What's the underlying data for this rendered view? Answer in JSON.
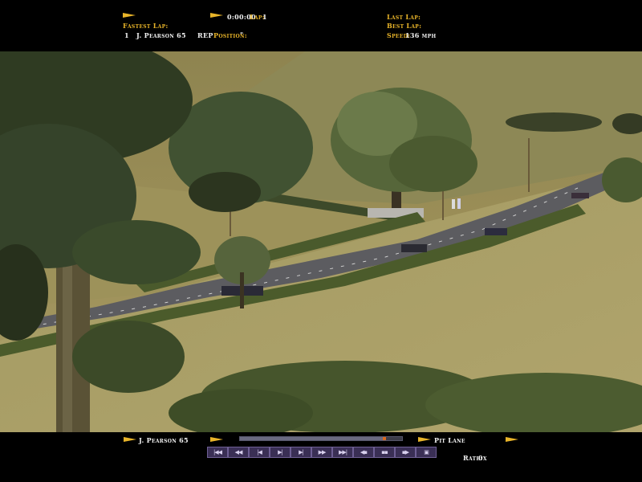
{
  "hud_top": {
    "fastest_lap_label": "Fastest Lap:",
    "fastest_lap_pos": "1",
    "fastest_lap_driver": "J. Pearson 65",
    "rep_label": "REP",
    "position_label": "Position:",
    "position_value": "\"",
    "time_value": "0:00:00",
    "lap_label": "Lap:",
    "lap_value": "1",
    "last_lap_label": "Last Lap:",
    "best_lap_label": "Best Lap:",
    "speed_label": "Speed:",
    "speed_value": "136 mph"
  },
  "hud_bottom": {
    "driver": "J. Pearson 65",
    "camera": "Pit Lane",
    "rate_label": "Rate:",
    "rate_value": "0x",
    "replay_progress": 0.9,
    "controls": [
      {
        "label": "|◀◀",
        "name": "skip-start-button"
      },
      {
        "label": "◀◀",
        "name": "rewind-fast-button"
      },
      {
        "label": "|◀",
        "name": "step-back-button"
      },
      {
        "label": "▶|",
        "name": "play-pause-button"
      },
      {
        "label": "▶|",
        "name": "step-forward-button"
      },
      {
        "label": "▶▶",
        "name": "forward-fast-button"
      },
      {
        "label": "▶▶|",
        "name": "skip-end-button"
      },
      {
        "label": "◀▪",
        "name": "prev-camera-button"
      },
      {
        "label": "▪▪",
        "name": "camera-button"
      },
      {
        "label": "▪▶",
        "name": "next-camera-button"
      },
      {
        "label": "▣",
        "name": "exit-replay-button"
      }
    ]
  },
  "colors": {
    "hud_gold": "#e8b429",
    "hud_white": "#f2f2f2",
    "button_bg": "#3a2f55",
    "progress_marker": "#d86a20"
  }
}
